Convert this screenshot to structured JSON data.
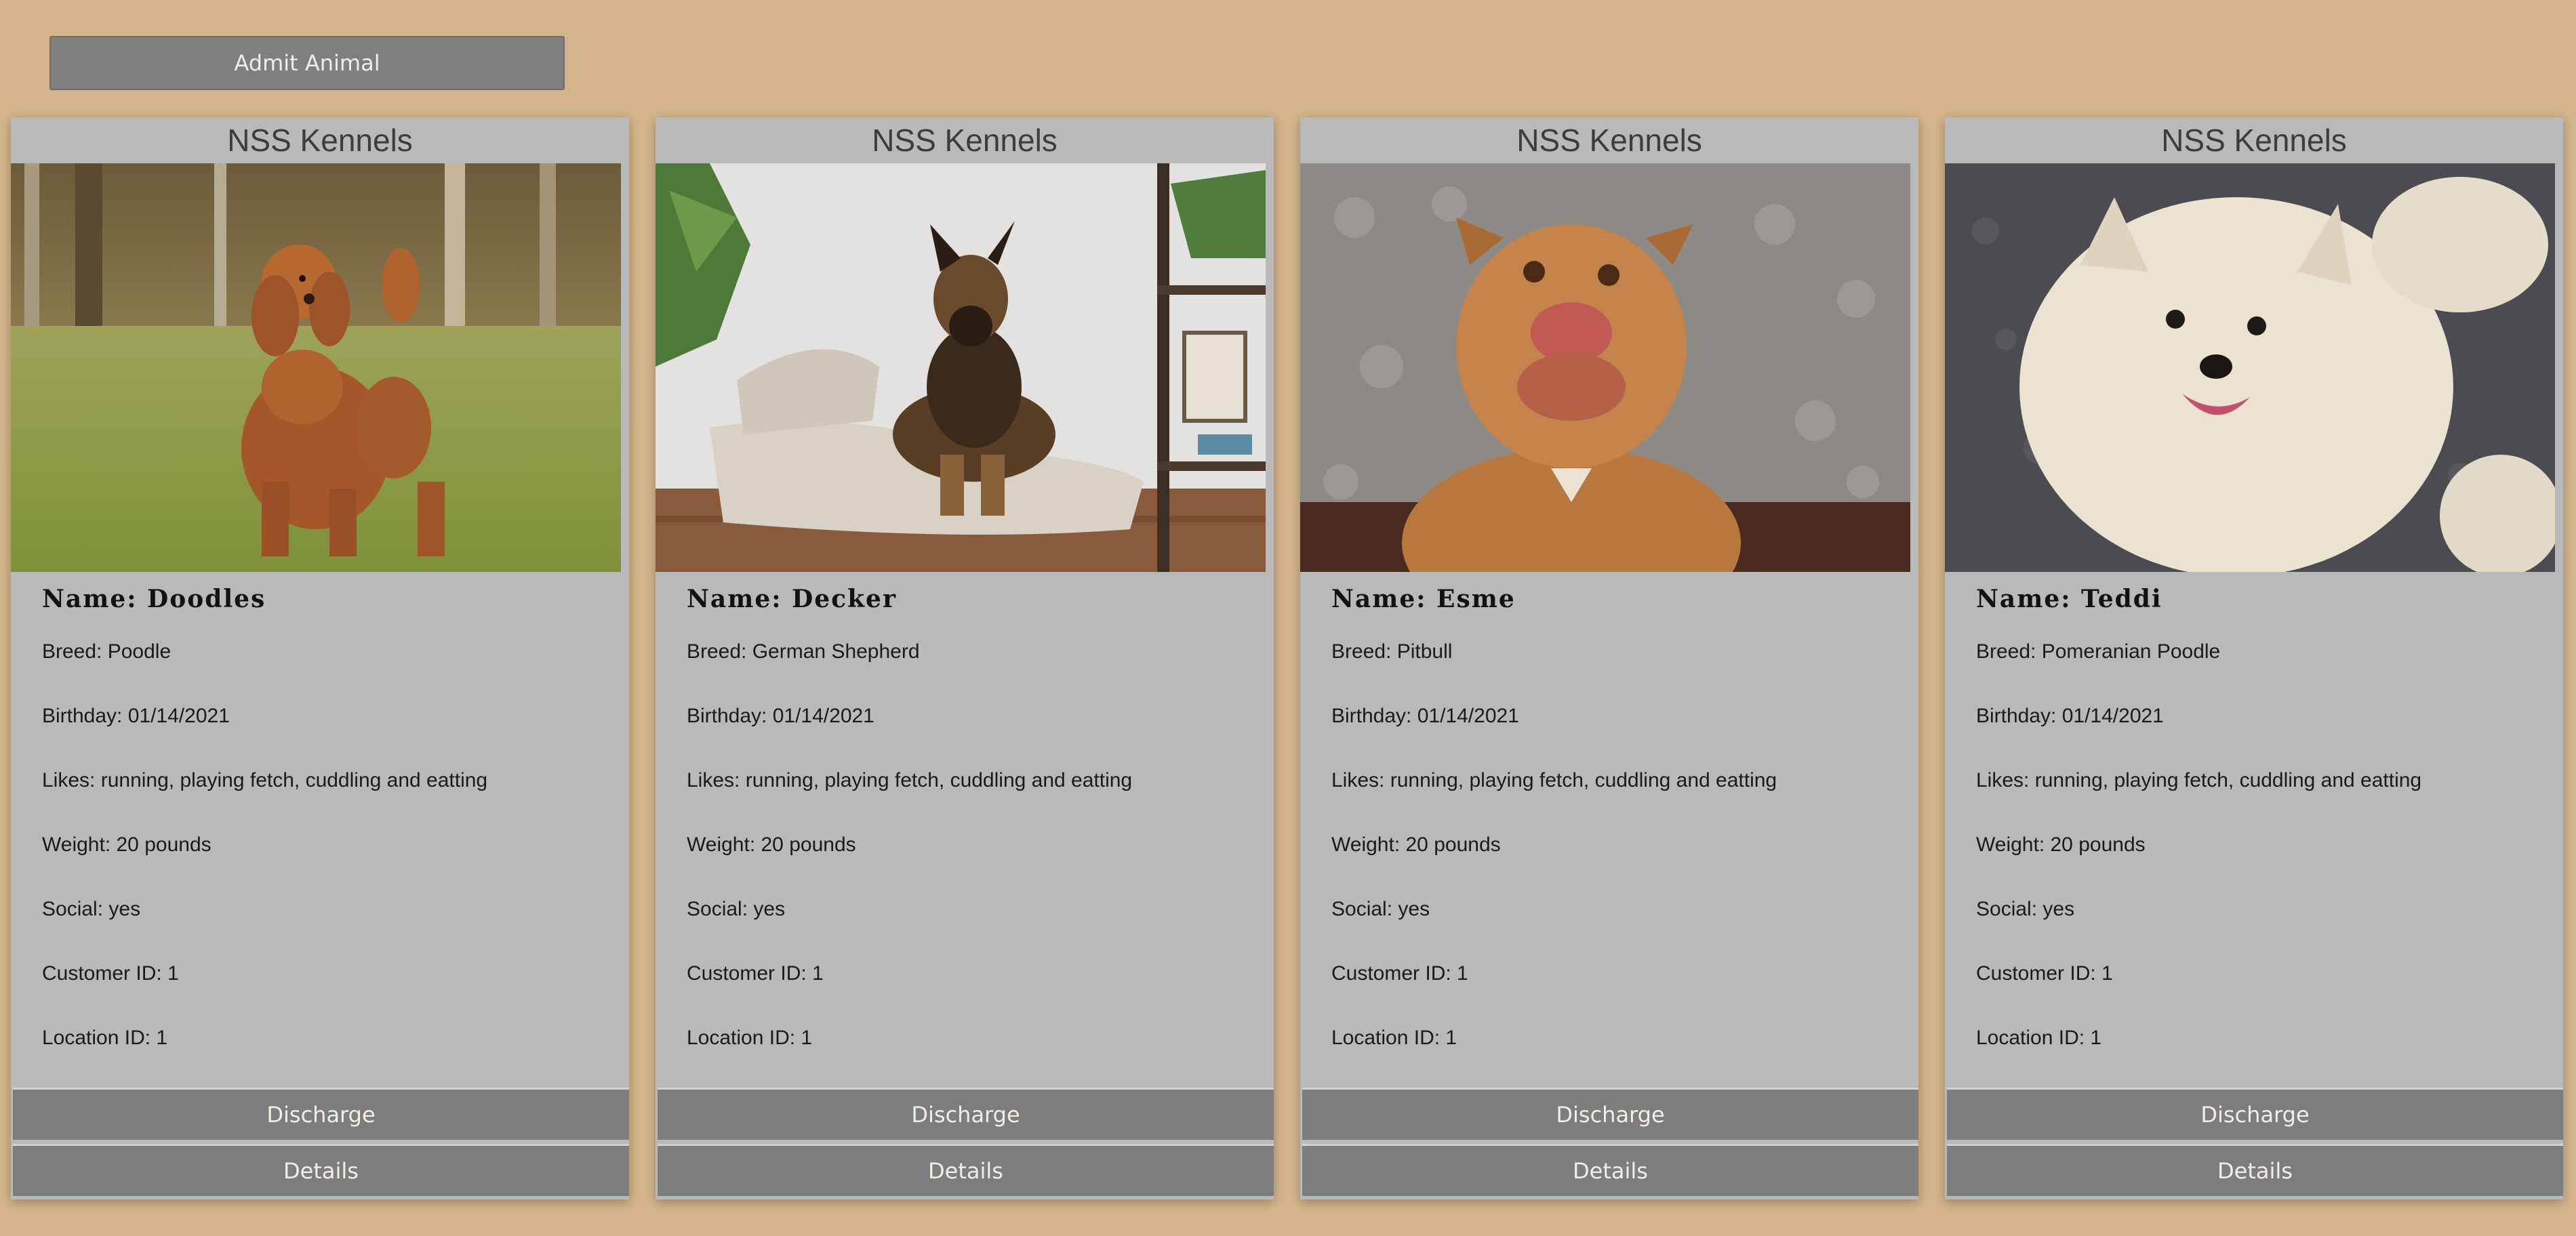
{
  "toolbar": {
    "admit_label": "Admit Animal"
  },
  "cards": [
    {
      "header": "NSS Kennels",
      "name": "Name: Doodles",
      "breed": "Breed: Poodle",
      "birthday": "Birthday: 01/14/2021",
      "likes": "Likes: running, playing fetch, cuddling and eatting",
      "weight": "Weight: 20 pounds",
      "social": "Social: yes",
      "customer": "Customer ID: 1",
      "location": "Location ID: 1",
      "discharge_label": "Discharge",
      "details_label": "Details"
    },
    {
      "header": "NSS Kennels",
      "name": "Name: Decker",
      "breed": "Breed: German Shepherd",
      "birthday": "Birthday: 01/14/2021",
      "likes": "Likes: running, playing fetch, cuddling and eatting",
      "weight": "Weight: 20 pounds",
      "social": "Social: yes",
      "customer": "Customer ID: 1",
      "location": "Location ID: 1",
      "discharge_label": "Discharge",
      "details_label": "Details"
    },
    {
      "header": "NSS Kennels",
      "name": "Name: Esme",
      "breed": "Breed: Pitbull",
      "birthday": "Birthday: 01/14/2021",
      "likes": "Likes: running, playing fetch, cuddling and eatting",
      "weight": "Weight: 20 pounds",
      "social": "Social: yes",
      "customer": "Customer ID: 1",
      "location": "Location ID: 1",
      "discharge_label": "Discharge",
      "details_label": "Details"
    },
    {
      "header": "NSS Kennels",
      "name": "Name: Teddi",
      "breed": "Breed: Pomeranian Poodle",
      "birthday": "Birthday: 01/14/2021",
      "likes": "Likes: running, playing fetch, cuddling and eatting",
      "weight": "Weight: 20 pounds",
      "social": "Social: yes",
      "customer": "Customer ID: 1",
      "location": "Location ID: 1",
      "discharge_label": "Discharge",
      "details_label": "Details"
    }
  ]
}
